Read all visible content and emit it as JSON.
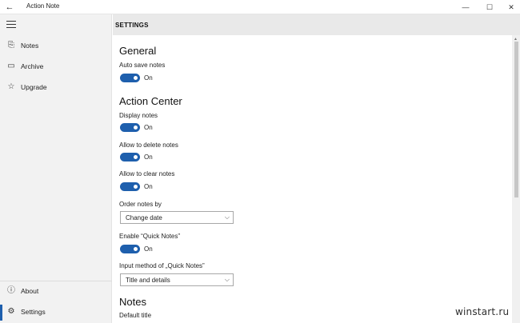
{
  "titlebar": {
    "title": "Action Note",
    "back_glyph": "←",
    "minimize_glyph": "—",
    "maximize_glyph": "☐",
    "close_glyph": "✕"
  },
  "sidebar": {
    "items": [
      {
        "label": "Notes",
        "icon": "notes-icon",
        "glyph": "⎘"
      },
      {
        "label": "Archive",
        "icon": "archive-icon",
        "glyph": "▭"
      },
      {
        "label": "Upgrade",
        "icon": "star-icon",
        "glyph": "☆"
      }
    ],
    "bottom_items": [
      {
        "label": "About",
        "icon": "info-icon",
        "glyph": "ⓘ"
      },
      {
        "label": "Settings",
        "icon": "gear-icon",
        "glyph": "⚙",
        "selected": true
      }
    ]
  },
  "header": {
    "title": "SETTINGS"
  },
  "settings": {
    "general": {
      "title": "General",
      "auto_save": {
        "label": "Auto save notes",
        "state": "On",
        "on": true
      }
    },
    "action_center": {
      "title": "Action Center",
      "display_notes": {
        "label": "Display notes",
        "state": "On",
        "on": true
      },
      "allow_delete": {
        "label": "Allow to delete notes",
        "state": "On",
        "on": true
      },
      "allow_clear": {
        "label": "Allow to clear notes",
        "state": "On",
        "on": true
      },
      "order_by": {
        "label": "Order notes by",
        "value": "Change date"
      },
      "quick_notes": {
        "label": "Enable “Quick Notes”",
        "state": "On",
        "on": true
      },
      "input_method": {
        "label": "Input method of „Quick Notes”",
        "value": "Title and details"
      }
    },
    "notes": {
      "title": "Notes",
      "default_title": {
        "label": "Default title"
      }
    }
  },
  "colors": {
    "accent": "#1e5fad",
    "sidebar_bg": "#f2f2f2",
    "header_bg": "#e9e9e9"
  },
  "watermark": "winstart.ru"
}
